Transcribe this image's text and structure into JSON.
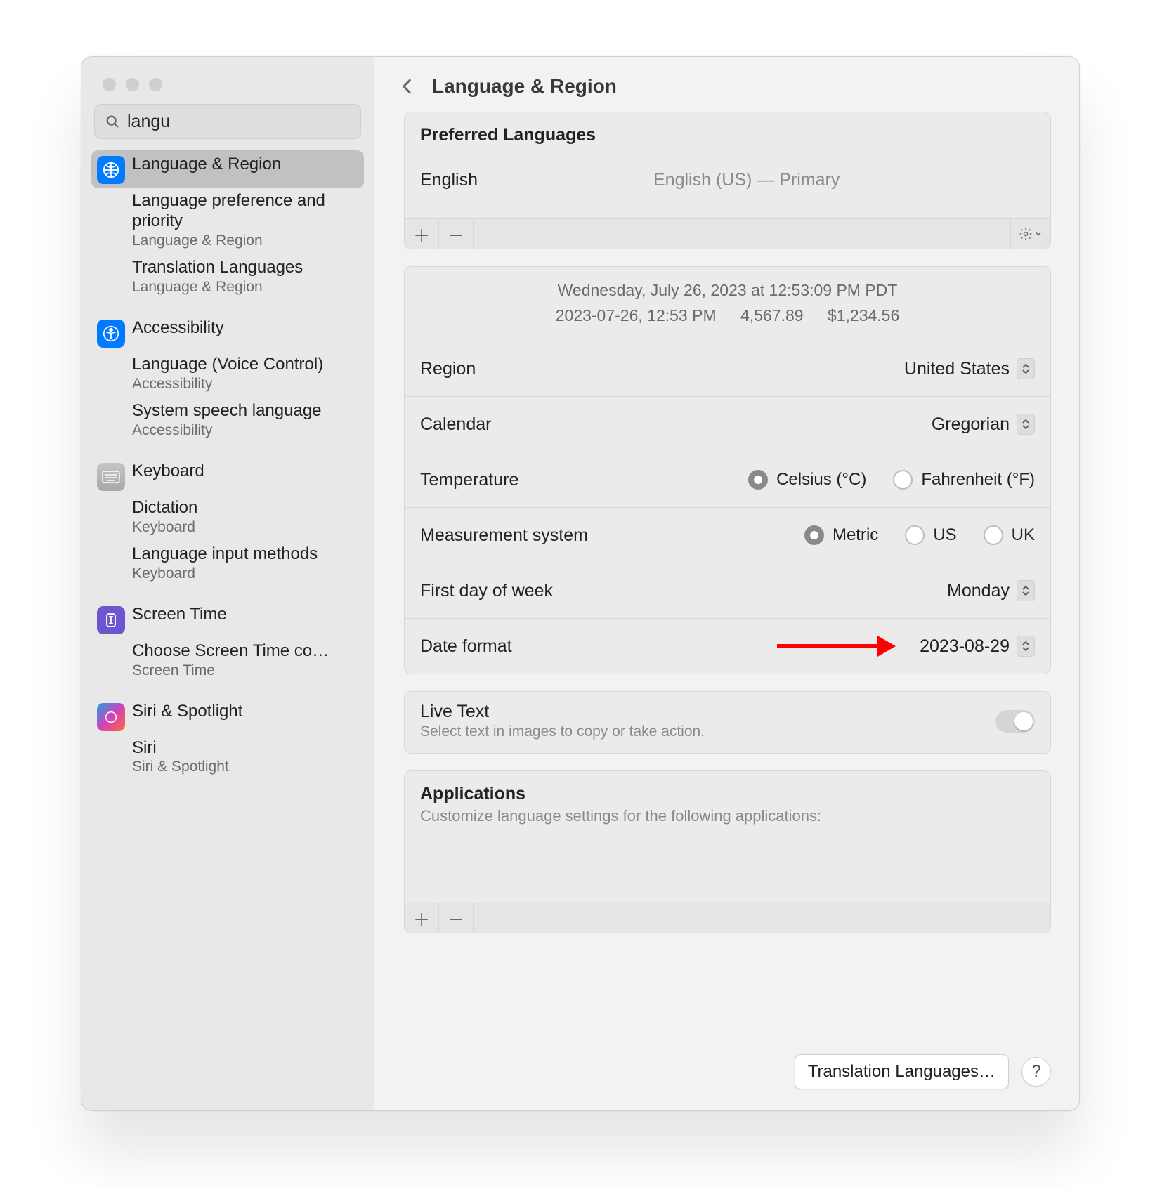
{
  "header": {
    "title": "Language & Region"
  },
  "search": {
    "value": "langu",
    "placeholder": "Search"
  },
  "sidebar": {
    "groups": [
      {
        "icon": "globe-icon",
        "icon_class": "ico-blue",
        "label": "Language & Region",
        "active": true,
        "children": [
          {
            "title": "Language preference and priority",
            "sub": "Language & Region"
          },
          {
            "title": "Translation Languages",
            "sub": "Language & Region"
          }
        ]
      },
      {
        "icon": "accessibility-icon",
        "icon_class": "ico-blue",
        "label": "Accessibility",
        "children": [
          {
            "title": "Language (Voice Control)",
            "sub": "Accessibility"
          },
          {
            "title": "System speech language",
            "sub": "Accessibility"
          }
        ]
      },
      {
        "icon": "keyboard-icon",
        "icon_class": "ico-gray",
        "label": "Keyboard",
        "children": [
          {
            "title": "Dictation",
            "sub": "Keyboard"
          },
          {
            "title": "Language input methods",
            "sub": "Keyboard"
          }
        ]
      },
      {
        "icon": "screentime-icon",
        "icon_class": "ico-purple",
        "label": "Screen Time",
        "children": [
          {
            "title": "Choose Screen Time co…",
            "sub": "Screen Time"
          }
        ]
      },
      {
        "icon": "siri-icon",
        "icon_class": "ico-siri",
        "label": "Siri & Spotlight",
        "children": [
          {
            "title": "Siri",
            "sub": "Siri & Spotlight"
          }
        ]
      }
    ]
  },
  "preferred": {
    "heading": "Preferred Languages",
    "language": "English",
    "detail": "English (US) — Primary"
  },
  "example": {
    "line1": "Wednesday, July 26, 2023 at 12:53:09 PM PDT",
    "line2a": "2023-07-26, 12:53 PM",
    "line2b": "4,567.89",
    "line2c": "$1,234.56"
  },
  "settings": {
    "region_label": "Region",
    "region_value": "United States",
    "calendar_label": "Calendar",
    "calendar_value": "Gregorian",
    "temperature_label": "Temperature",
    "temperature_options": [
      {
        "label": "Celsius (°C)",
        "selected": true
      },
      {
        "label": "Fahrenheit (°F)",
        "selected": false
      }
    ],
    "measurement_label": "Measurement system",
    "measurement_options": [
      {
        "label": "Metric",
        "selected": true
      },
      {
        "label": "US",
        "selected": false
      },
      {
        "label": "UK",
        "selected": false
      }
    ],
    "firstday_label": "First day of week",
    "firstday_value": "Monday",
    "dateformat_label": "Date format",
    "dateformat_value": "2023-08-29"
  },
  "livetext": {
    "title": "Live Text",
    "subtitle": "Select text in images to copy or take action.",
    "enabled": false
  },
  "applications": {
    "title": "Applications",
    "subtitle": "Customize language settings for the following applications:"
  },
  "footer": {
    "translation_button": "Translation Languages…",
    "help": "?"
  },
  "annotation": {
    "color": "#ff0000"
  }
}
